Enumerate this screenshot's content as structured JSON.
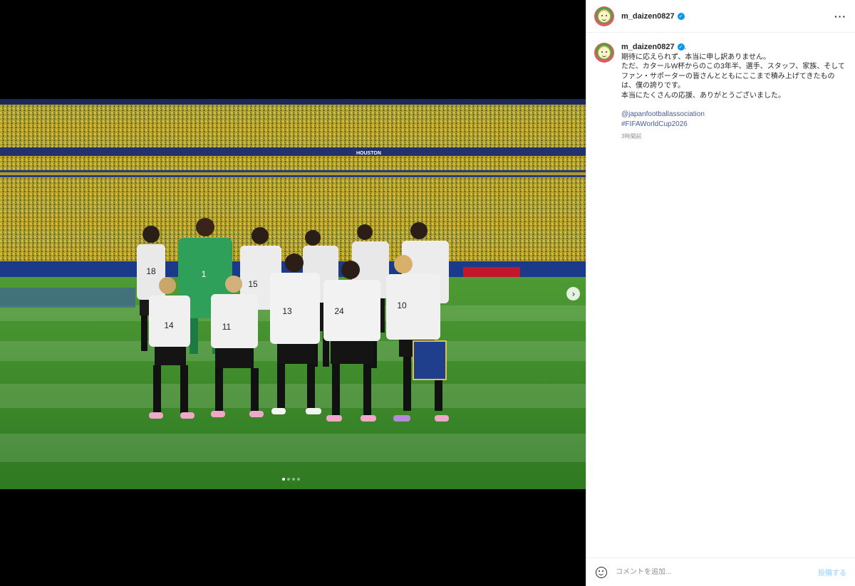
{
  "post": {
    "username": "m_daizen0827",
    "verified_glyph": "✓",
    "more_label": "···",
    "caption_suffix": ".",
    "caption_lines": [
      "期待に応えられず、本当に申し訳ありません。",
      "ただ、カタールW杯からのこの3年半、選手、スタッフ、家族、そしてファン・サポーターの皆さんとともにここまで積み上げてきたものは、僕の誇りです。",
      "本当にたくさんの応援、ありがとうございました。"
    ],
    "tags": [
      "@japanfootballassociation",
      "#FIFAWorldCup2026"
    ],
    "time_ago": "3時間前"
  },
  "comment": {
    "placeholder": "コメントを追加...",
    "post_label": "投稿する"
  },
  "carousel": {
    "next_glyph": "›",
    "slide_count": 4,
    "active_slide": 1
  },
  "stadium_banner": "HOUSTON",
  "players_back": [
    "18",
    "1",
    "15",
    "",
    "",
    ""
  ],
  "players_front": [
    "14",
    "11",
    "13",
    "24",
    "10"
  ],
  "colors": {
    "accent": "#0095f6",
    "tag": "#4a5d9e",
    "post_disabled": "#b2dffc",
    "pitch": "#3f8a2e",
    "crowd": "#c9b42a"
  },
  "icons": {
    "verified": "verified-badge-icon",
    "more": "more-options-icon",
    "emoji": "emoji-icon",
    "next": "chevron-right-icon"
  }
}
